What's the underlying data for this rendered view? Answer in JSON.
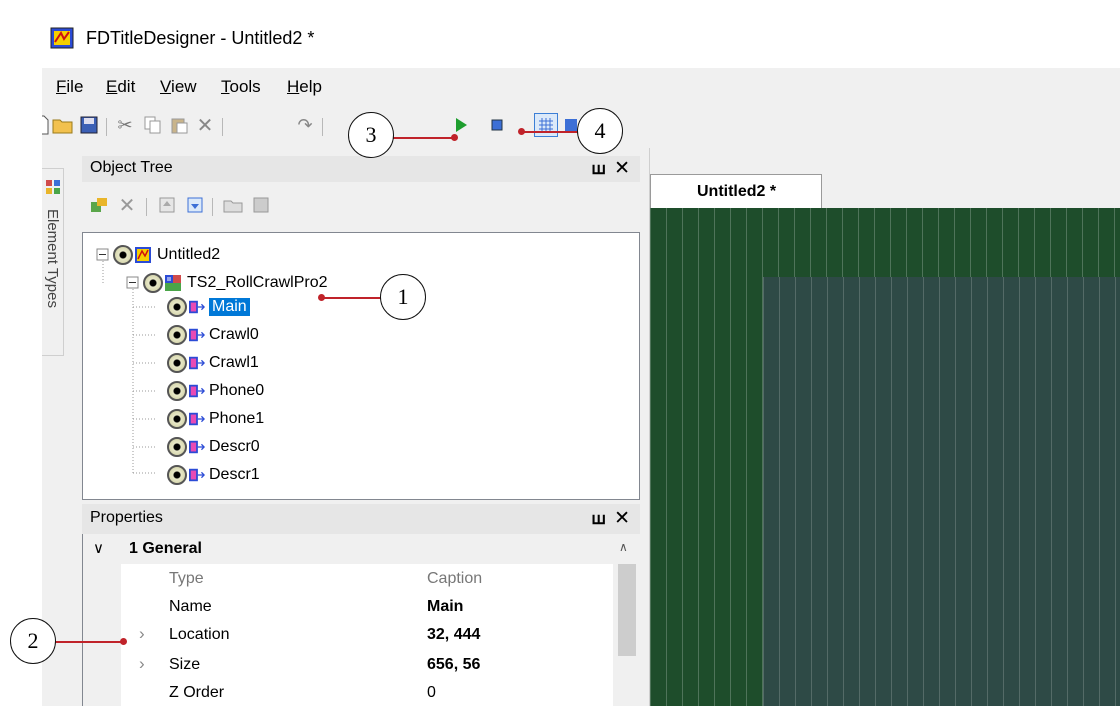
{
  "window": {
    "title": "FDTitleDesigner - Untitled2 *"
  },
  "menu": [
    {
      "ul": "F",
      "rest": "ile"
    },
    {
      "ul": "E",
      "rest": "dit"
    },
    {
      "ul": "V",
      "rest": "iew"
    },
    {
      "ul": "T",
      "rest": "ools"
    },
    {
      "ul": "H",
      "rest": "elp"
    }
  ],
  "side_strip": {
    "label": "Element Types"
  },
  "object_tree": {
    "title": "Object Tree",
    "pin": "ꟺ",
    "close": "✕",
    "root": "Untitled2",
    "child": "TS2_RollCrawlPro2",
    "items": [
      "Main",
      "Crawl0",
      "Crawl1",
      "Phone0",
      "Phone1",
      "Descr0",
      "Descr1"
    ]
  },
  "properties": {
    "title": "Properties",
    "pin": "ꟺ",
    "close": "✕",
    "category": "1 General",
    "rows": [
      {
        "name": "Type",
        "value": "Caption"
      },
      {
        "name": "Name",
        "value": "Main"
      },
      {
        "name": "Location",
        "value": "32, 444"
      },
      {
        "name": "Size",
        "value": "656, 56"
      },
      {
        "name": "Z Order",
        "value": "0"
      }
    ]
  },
  "document": {
    "tab": "Untitled2 *"
  },
  "callouts": [
    "1",
    "2",
    "3",
    "4"
  ],
  "colors": {
    "accent": "#0078d7",
    "canvas_outer": "#1e4d2b",
    "canvas_inner": "#2e4a46",
    "leader": "#c0232a"
  }
}
